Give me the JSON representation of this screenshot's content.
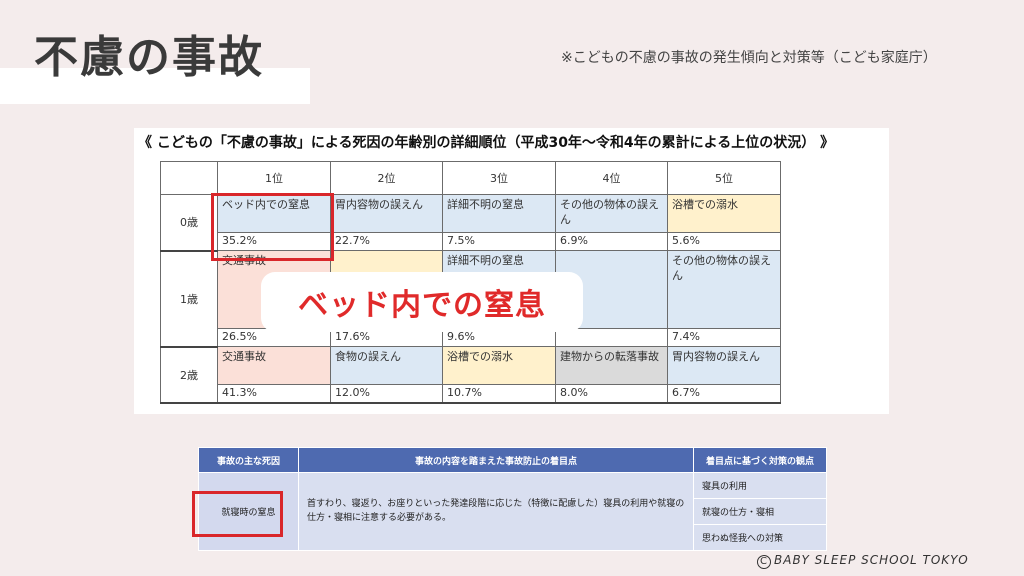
{
  "header": {
    "title": "不慮の事故",
    "source_note": "※こどもの不慮の事故の発生傾向と対策等（こども家庭庁）"
  },
  "figure": {
    "caption": "《 こどもの「不慮の事故」による死因の年齢別の詳細順位（平成30年～令和4年の累計による上位の状況） 》",
    "ranks": [
      "1位",
      "2位",
      "3位",
      "4位",
      "5位"
    ],
    "rows": [
      {
        "age": "0歳",
        "cells": [
          {
            "cause": "ベッド内での窒息",
            "pct": "35.2%",
            "color": "#dce8f4"
          },
          {
            "cause": "胃内容物の誤えん",
            "pct": "22.7%",
            "color": "#dce8f4"
          },
          {
            "cause": "詳細不明の窒息",
            "pct": "7.5%",
            "color": "#dce8f4"
          },
          {
            "cause": "その他の物体の誤えん",
            "pct": "6.9%",
            "color": "#dce8f4"
          },
          {
            "cause": "浴槽での溺水",
            "pct": "5.6%",
            "color": "#fff1cc"
          }
        ]
      },
      {
        "age": "1歳",
        "cells": [
          {
            "cause": "交通事故",
            "pct": "26.5%",
            "color": "#fbe0d8"
          },
          {
            "cause": "",
            "pct": "17.6%",
            "color": "#fff1cc"
          },
          {
            "cause": "詳細不明の窒息",
            "pct": "9.6%",
            "color": "#dce8f4"
          },
          {
            "cause": "",
            "pct": "",
            "color": "#dce8f4"
          },
          {
            "cause": "その他の物体の誤えん",
            "pct": "7.4%",
            "color": "#dce8f4"
          }
        ]
      },
      {
        "age": "2歳",
        "cells": [
          {
            "cause": "交通事故",
            "pct": "41.3%",
            "color": "#fbe0d8"
          },
          {
            "cause": "食物の誤えん",
            "pct": "12.0%",
            "color": "#dce8f4"
          },
          {
            "cause": "浴槽での溺水",
            "pct": "10.7%",
            "color": "#fff1cc"
          },
          {
            "cause": "建物からの転落事故",
            "pct": "8.0%",
            "color": "#dadada"
          },
          {
            "cause": "胃内容物の誤えん",
            "pct": "6.7%",
            "color": "#dce8f4"
          }
        ]
      }
    ]
  },
  "callout": {
    "label": "ベッド内での窒息"
  },
  "measures": {
    "headers": [
      "事故の主な死因",
      "事故の内容を踏まえた事故防止の着目点",
      "着目点に基づく対策の観点"
    ],
    "cause": "就寝時の窒息",
    "content": "首すわり、寝返り、お座りといった発達段階に応じた（特徴に配慮した）寝具の利用や就寝の仕方・寝相に注意する必要がある。",
    "points": [
      "寝具の利用",
      "就寝の仕方・寝相",
      "思わぬ怪我への対策"
    ]
  },
  "footer": {
    "copyright_mark": "C",
    "copyright": "BABY SLEEP SCHOOL TOKYO"
  }
}
